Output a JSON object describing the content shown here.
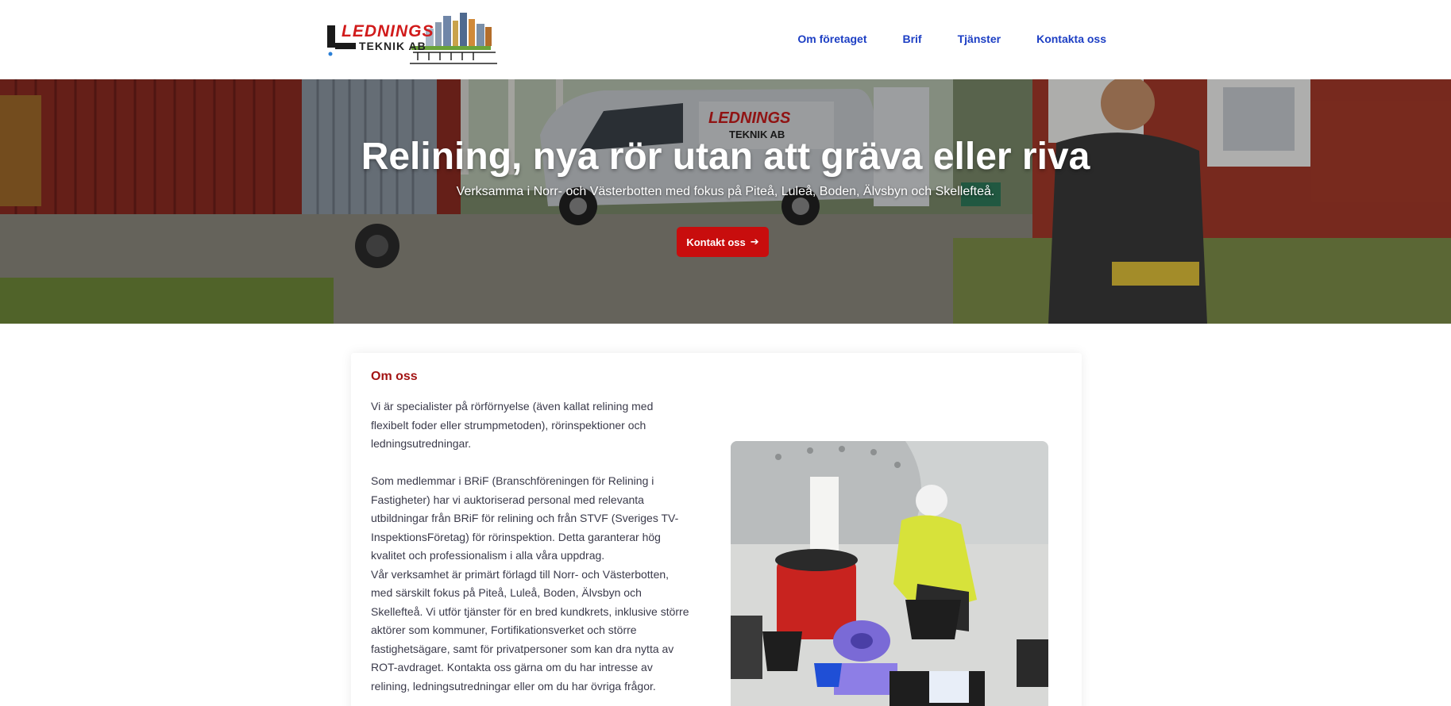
{
  "logo": {
    "line1": "LEDNINGS",
    "line2": "TEKNIK AB",
    "accent": "#d11b1b"
  },
  "nav": {
    "items": [
      {
        "label": "Om företaget"
      },
      {
        "label": "Brif"
      },
      {
        "label": "Tjänster"
      },
      {
        "label": "Kontakta oss"
      }
    ],
    "color": "#1d3fc4"
  },
  "hero": {
    "title": "Relining, nya rör utan att gräva eller riva",
    "subtitle": "Verksamma i Norr- och Västerbotten med fokus på Piteå, Luleå, Boden, Älvsbyn och Skellefteå.",
    "button_label": "Kontakt oss",
    "button_icon": "arrow-right-icon",
    "van_text": "LEDNINGS",
    "van_text2": "TEKNIK AB",
    "button_color": "#c80d0d"
  },
  "about": {
    "title": "Om oss",
    "paragraphs": [
      "Vi är specialister på rörförnyelse (även kallat relining med flexibelt foder eller strumpmetoden), rörinspektioner och ledningsutredningar.",
      "Som medlemmar i BRiF (Branschföreningen för Relining i Fastigheter) har vi auktoriserad personal med relevanta utbildningar från BRiF för relining och från STVF (Sveriges TV-InspektionsFöretag) för rörinspektion. Detta garanterar hög kvalitet och professionalism i alla våra uppdrag.",
      "Vår verksamhet är primärt förlagd till Norr- och Västerbotten, med särskilt fokus på Piteå, Luleå, Boden, Älvsbyn och Skellefteå. Vi utför tjänster för en bred kundkrets, inklusive större aktörer som kommuner, Fortifikationsverket och större fastighetsägare, samt för privatpersoner som kan dra nytta av ROT-avdraget. Kontakta oss gärna om du har intresse av relining, ledningsutredningar eller om du har övriga frågor."
    ],
    "title_color": "#a31313"
  }
}
